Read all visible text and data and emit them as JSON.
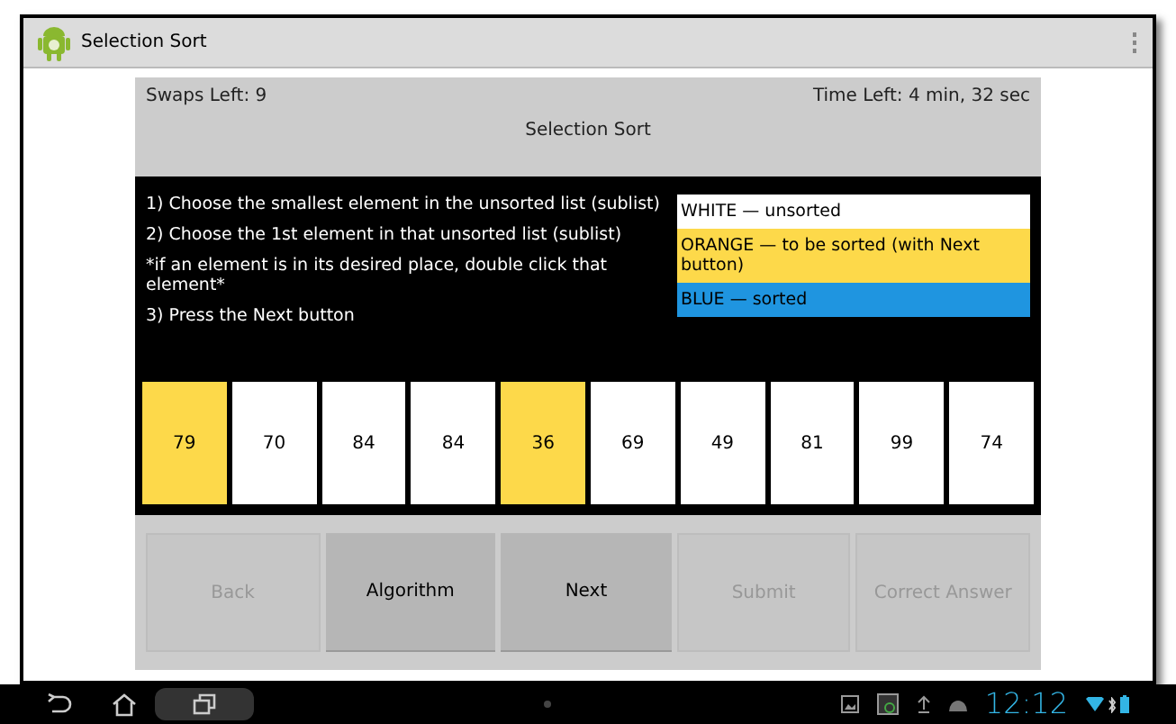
{
  "window": {
    "title": "Selection Sort"
  },
  "header": {
    "swaps": "Swaps Left: 9",
    "time": "Time Left: 4 min, 32 sec",
    "title": "Selection Sort"
  },
  "instructions": [
    "1) Choose the smallest element in the unsorted list (sublist)",
    "2) Choose the 1st element in that unsorted list (sublist)",
    "*if an element is in its desired place, double click that element*",
    "3) Press the Next button"
  ],
  "legend": [
    {
      "label": "WHITE — unsorted",
      "color": "#ffffff"
    },
    {
      "label": "ORANGE — to be sorted (with Next button)",
      "color": "#fdd94a"
    },
    {
      "label": "BLUE — sorted",
      "color": "#1f95e0"
    }
  ],
  "cells": [
    {
      "value": "79",
      "color": "#fdd94a"
    },
    {
      "value": "70",
      "color": "#ffffff"
    },
    {
      "value": "84",
      "color": "#ffffff"
    },
    {
      "value": "84",
      "color": "#ffffff"
    },
    {
      "value": "36",
      "color": "#fdd94a"
    },
    {
      "value": "69",
      "color": "#ffffff"
    },
    {
      "value": "49",
      "color": "#ffffff"
    },
    {
      "value": "81",
      "color": "#ffffff"
    },
    {
      "value": "99",
      "color": "#ffffff"
    },
    {
      "value": "74",
      "color": "#ffffff"
    }
  ],
  "buttons": [
    {
      "label": "Back",
      "disabled": true
    },
    {
      "label": "Algorithm",
      "disabled": false
    },
    {
      "label": "Next",
      "disabled": false
    },
    {
      "label": "Submit",
      "disabled": true
    },
    {
      "label": "Correct Answer",
      "disabled": true
    }
  ],
  "status_bar": {
    "time": "12:12"
  }
}
